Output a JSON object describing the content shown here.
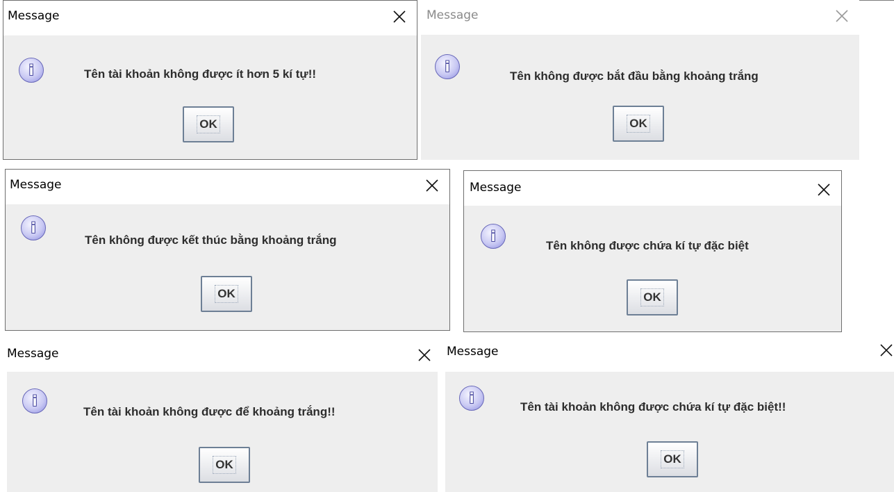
{
  "dialogs": [
    {
      "title": "Message",
      "message": "Tên tài khoản không được ít hơn 5 kí tự!!",
      "ok_label": "OK"
    },
    {
      "title": "Message",
      "message": "Tên không được bắt đầu bằng khoảng trắng",
      "ok_label": "OK"
    },
    {
      "title": "Message",
      "message": "Tên không được kết thúc bằng khoảng trắng",
      "ok_label": "OK"
    },
    {
      "title": "Message",
      "message": "Tên không được chứa kí tự đặc biệt",
      "ok_label": "OK"
    },
    {
      "title": "Message",
      "message": "Tên tài khoản không được để khoảng trắng!!",
      "ok_label": "OK"
    },
    {
      "title": "Message",
      "message": "Tên tài khoản không được chứa kí tự đặc biệt!!",
      "ok_label": "OK"
    }
  ],
  "icons": {
    "info": "info-icon",
    "close": "close-icon"
  },
  "info_glyph": "i",
  "colors": {
    "dialog_bg": "#eeeeee",
    "titlebar_bg": "#ffffff",
    "info_icon": "#c9c9f3",
    "faded_title": "#8a8a8a"
  }
}
